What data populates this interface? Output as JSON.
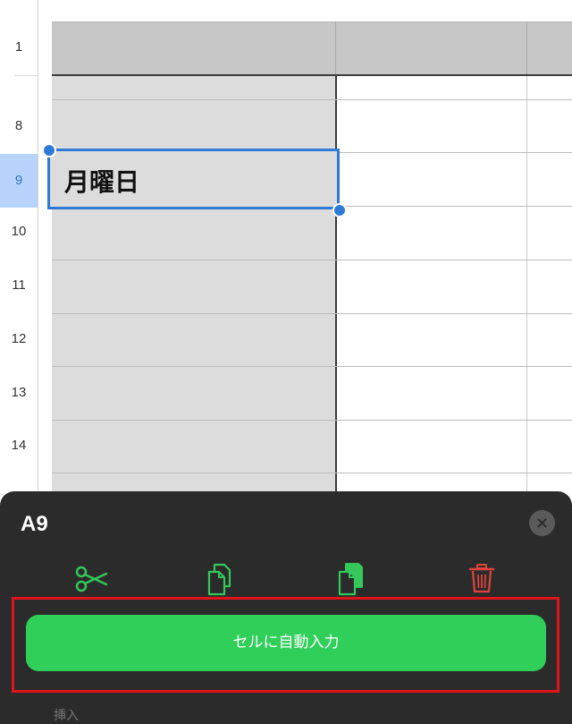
{
  "rows": [
    "1",
    "8",
    "9",
    "10",
    "11",
    "12",
    "13",
    "14"
  ],
  "selected_cell": {
    "value": "月曜日"
  },
  "panel": {
    "title": "A9",
    "close_symbol": "×",
    "tools": [
      {
        "name": "cut",
        "icon": "scissors-icon"
      },
      {
        "name": "copy",
        "icon": "copy-icon"
      },
      {
        "name": "paste",
        "icon": "paste-icon"
      },
      {
        "name": "delete",
        "icon": "trash-icon"
      }
    ],
    "autofill_label": "セルに自動入力",
    "peek_label": "挿入"
  },
  "colors": {
    "accent_green": "#2fcf5a",
    "selection_blue": "#2f7ad6",
    "delete_red": "#e0443b",
    "highlight_red": "#e0141b"
  }
}
